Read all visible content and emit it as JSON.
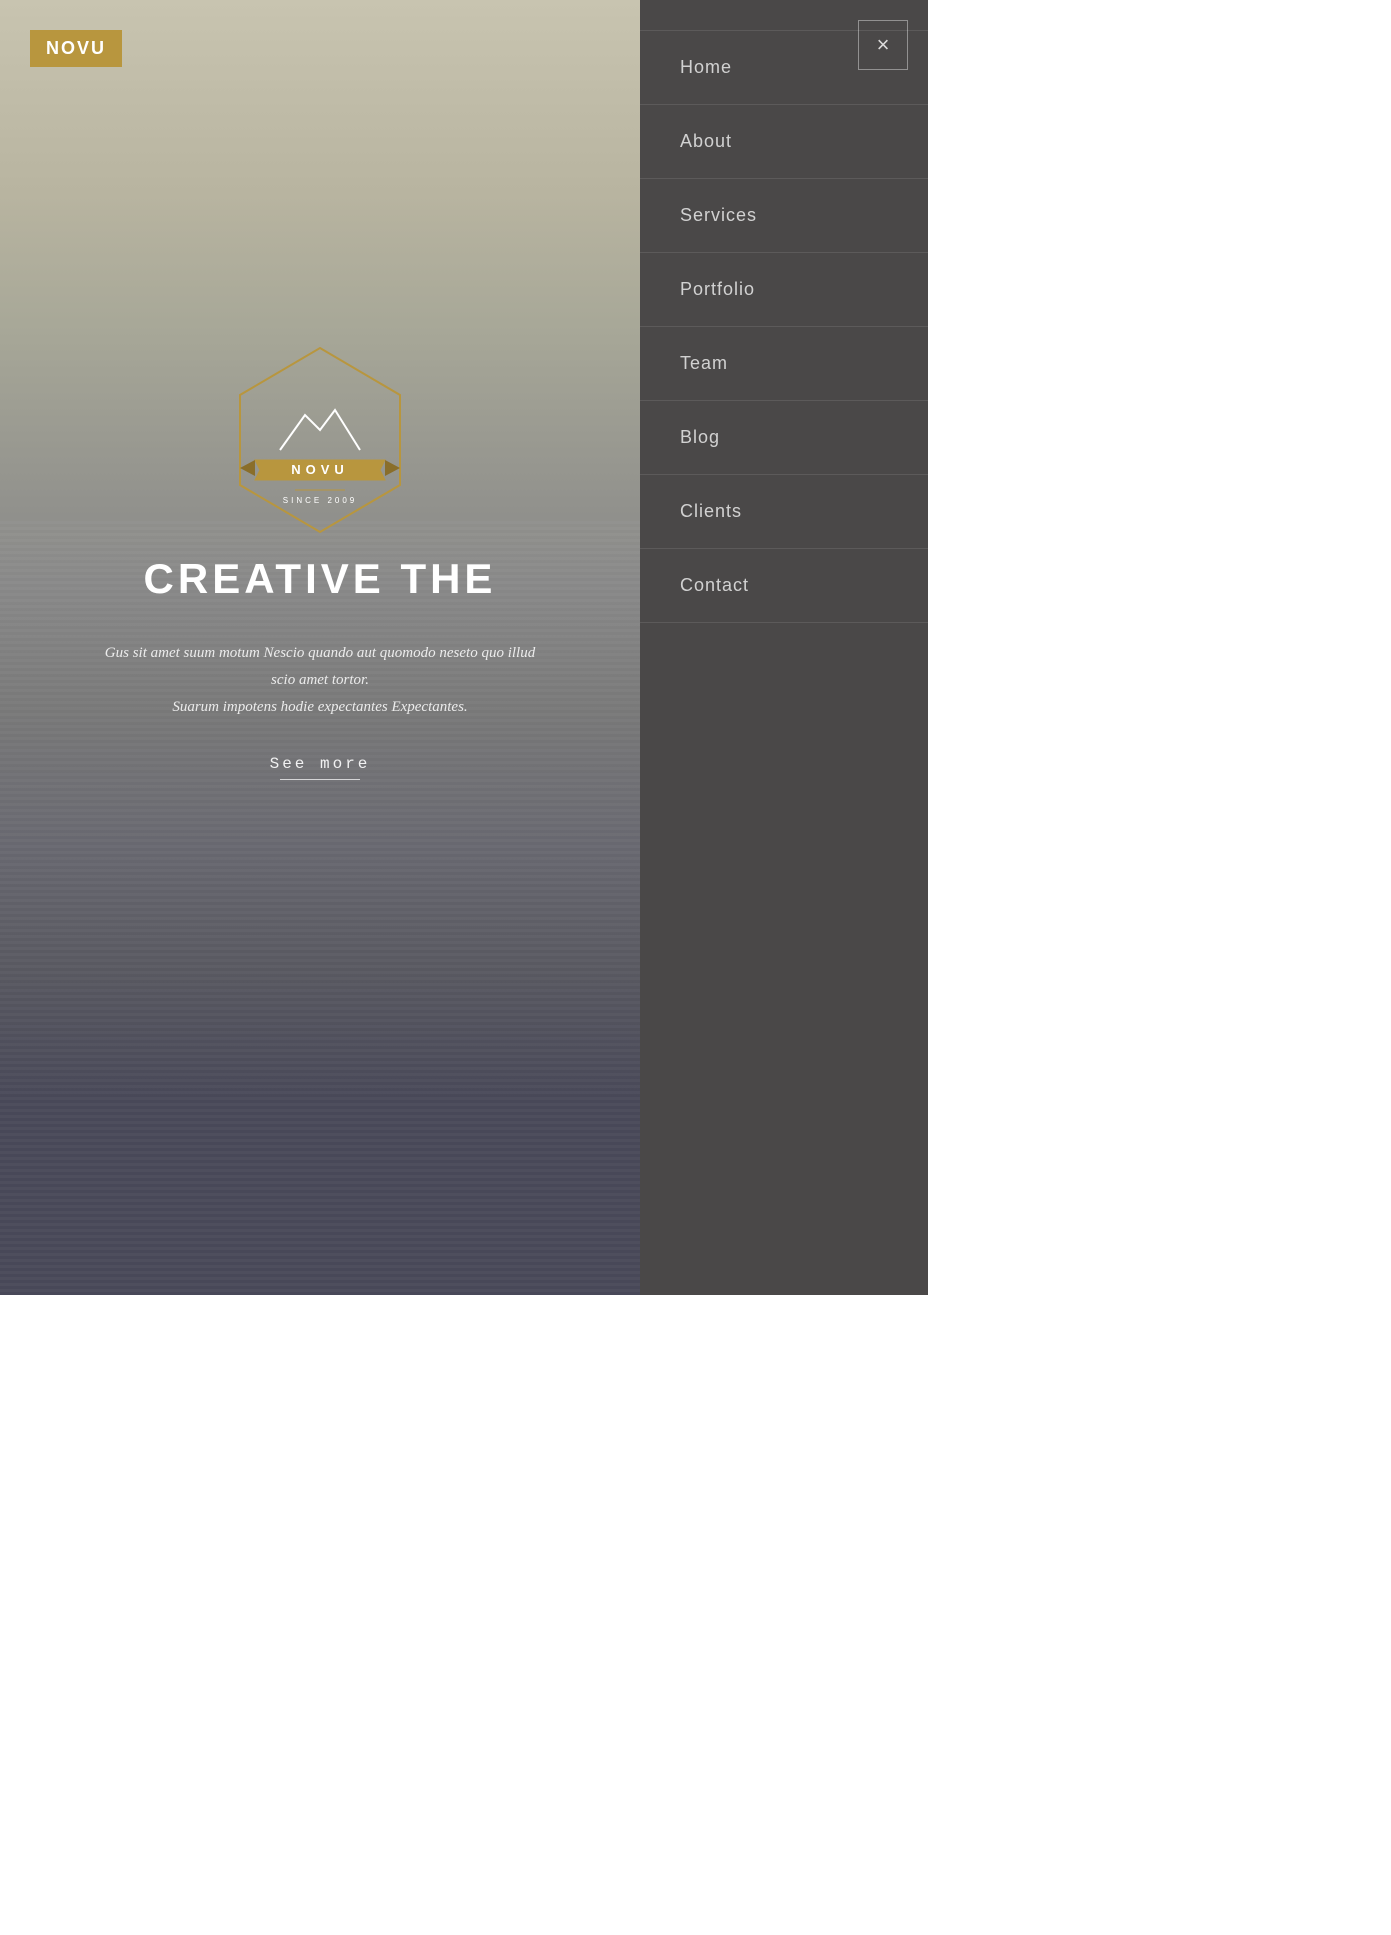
{
  "logo": {
    "text": "NOVU"
  },
  "hero": {
    "headline": "CREATIVE THE",
    "subtext_line1": "Gus sit amet suum motum Nescio quando aut quomodo neseto quo illud",
    "subtext_line2": "scio amet tortor.",
    "subtext_line3": "Suarum impotens hodie expectantes Expectantes.",
    "see_more": "See more"
  },
  "emblem": {
    "brand": "NOVU",
    "tagline": "SINCE 2009"
  },
  "nav": {
    "close_label": "×",
    "items": [
      {
        "label": "Home",
        "id": "home"
      },
      {
        "label": "About",
        "id": "about"
      },
      {
        "label": "Services",
        "id": "services"
      },
      {
        "label": "Portfolio",
        "id": "portfolio"
      },
      {
        "label": "Team",
        "id": "team"
      },
      {
        "label": "Blog",
        "id": "blog"
      },
      {
        "label": "Clients",
        "id": "clients"
      },
      {
        "label": "Contact",
        "id": "contact"
      }
    ]
  },
  "colors": {
    "accent": "#b8963e",
    "nav_bg": "#4a4848"
  }
}
